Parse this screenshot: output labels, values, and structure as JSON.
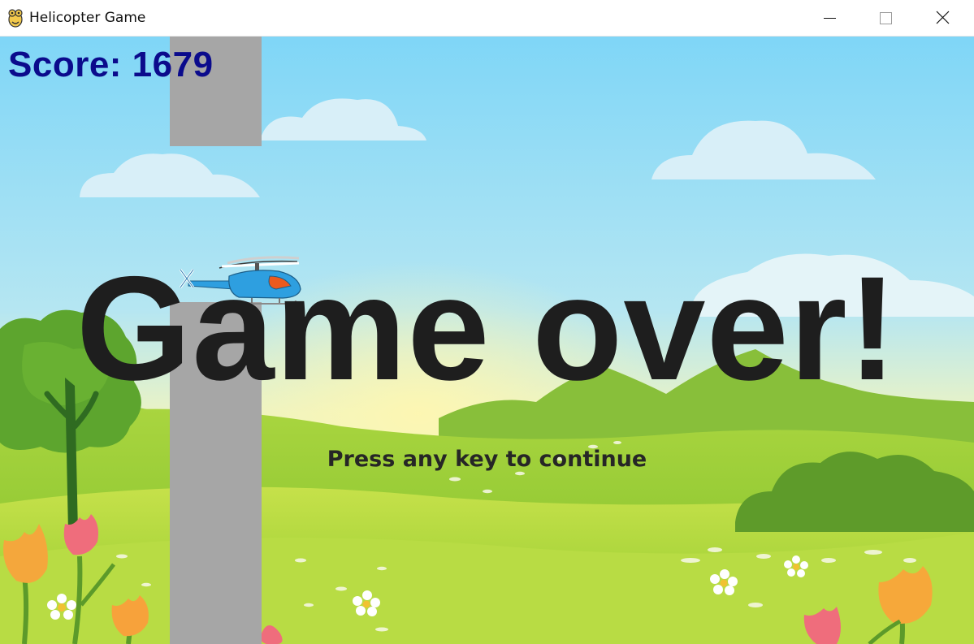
{
  "window": {
    "title": "Helicopter Game",
    "icon": "pygame-snake-icon",
    "controls": [
      "minimize-icon",
      "maximize-icon",
      "close-icon"
    ]
  },
  "game": {
    "score_text": "Score: 1679",
    "score": 1679,
    "message": "Game over!",
    "prompt": "Press any key to continue",
    "score_color": "#0b0b8c",
    "pillar_color": "#a6a6a6",
    "sky_color": "#7fd3f0",
    "grass_color": "#9bcf3a",
    "helicopter_color": "#2e9fe0"
  }
}
